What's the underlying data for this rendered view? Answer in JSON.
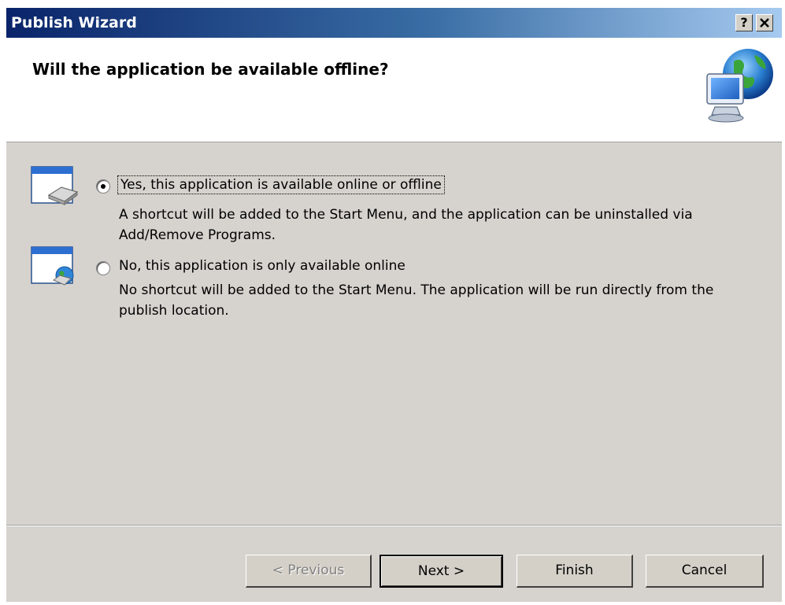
{
  "window": {
    "title": "Publish Wizard",
    "help_label": "?",
    "close_label": "X"
  },
  "header": {
    "question": "Will the application be available offline?",
    "icon": "globe-computer-icon"
  },
  "options": [
    {
      "label": "Yes, this application is available online or offline",
      "description": "A shortcut will be added to the Start Menu, and the application can be uninstalled via Add/Remove Programs.",
      "selected": true,
      "icon": "offline-app-window-icon"
    },
    {
      "label": "No, this application is only available online",
      "description": "No shortcut will be added to the Start Menu. The application will be run directly from the publish location.",
      "selected": false,
      "icon": "online-app-window-icon"
    }
  ],
  "buttons": {
    "previous": "< Previous",
    "next": "Next >",
    "finish": "Finish",
    "cancel": "Cancel"
  },
  "colors": {
    "titlebar_start": "#0a246a",
    "titlebar_end": "#a6caf0",
    "dialog_background": "#d6d3ce"
  }
}
